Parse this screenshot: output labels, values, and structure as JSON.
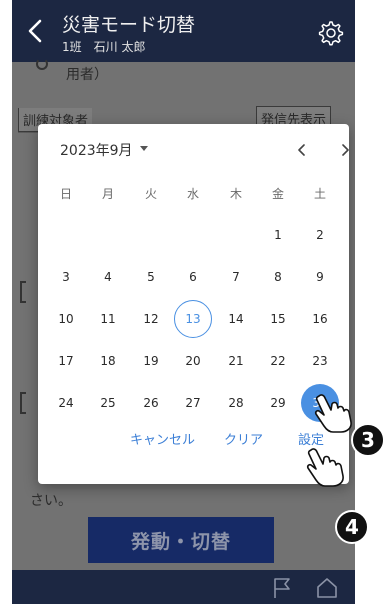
{
  "header": {
    "title": "災害モード切替",
    "subtitle": "1班　石川 太郎"
  },
  "background": {
    "line1": "用者）",
    "target_label": "訓練対象者",
    "show_dest_label": "発信先表示",
    "line_sai": "さい。",
    "activate_label": "発動・切替"
  },
  "calendar": {
    "month_label": "2023年9月",
    "weekdays": [
      "日",
      "月",
      "火",
      "水",
      "木",
      "金",
      "土"
    ],
    "weeks": [
      [
        "",
        "",
        "",
        "",
        "",
        "1",
        "2"
      ],
      [
        "3",
        "4",
        "5",
        "6",
        "7",
        "8",
        "9"
      ],
      [
        "10",
        "11",
        "12",
        "13",
        "14",
        "15",
        "16"
      ],
      [
        "17",
        "18",
        "19",
        "20",
        "21",
        "22",
        "23"
      ],
      [
        "24",
        "25",
        "26",
        "27",
        "28",
        "29",
        "30"
      ]
    ],
    "today": "13",
    "selected": "30",
    "cancel_label": "キャンセル",
    "clear_label": "クリア",
    "set_label": "設定"
  },
  "annotations": {
    "step3": "3",
    "step4": "4"
  },
  "colors": {
    "header_bg": "#1c2742",
    "accent": "#4a90e2",
    "activate_btn": "#162a66"
  }
}
